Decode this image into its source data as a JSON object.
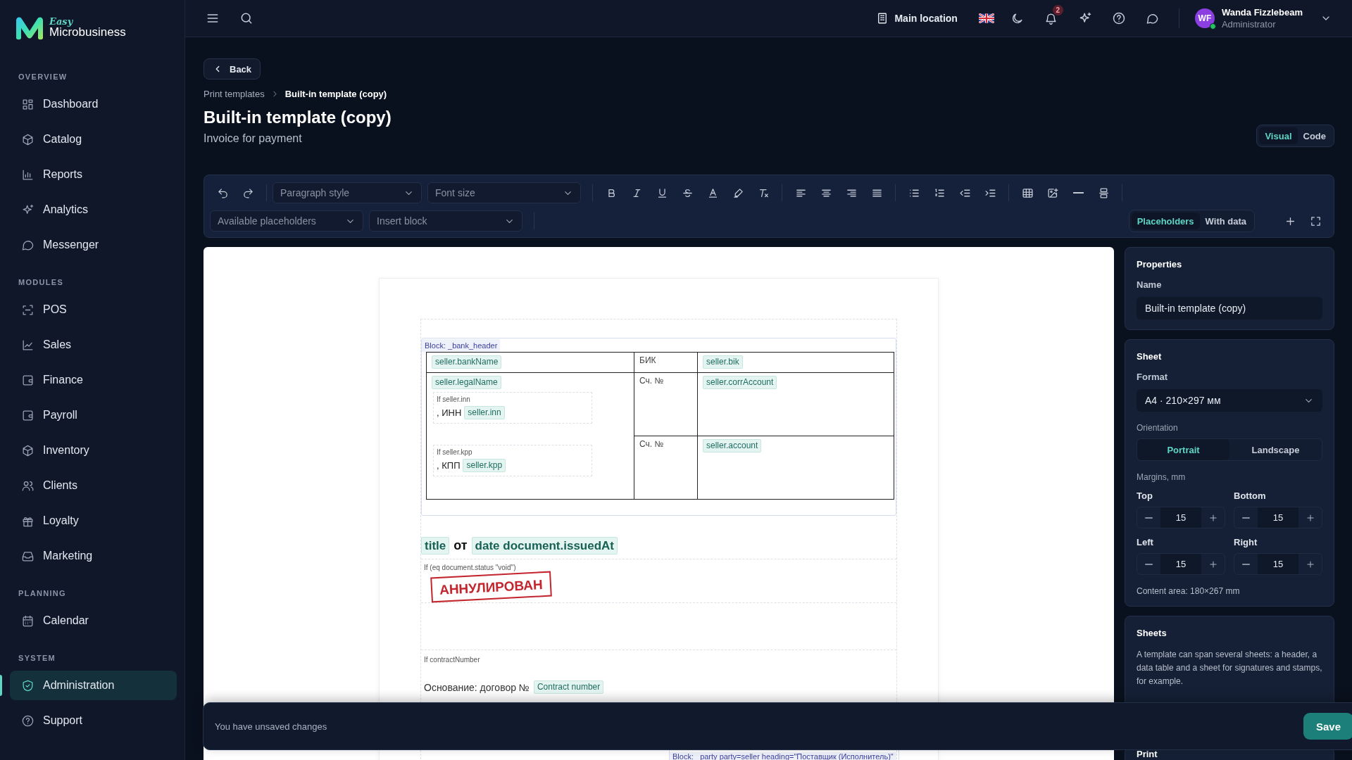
{
  "sidebar": {
    "logo": {
      "tagline": "Easy",
      "name": "Microbusiness"
    },
    "sections": [
      {
        "heading": "OVERVIEW",
        "items": [
          {
            "label": "Dashboard",
            "selected": false
          },
          {
            "label": "Catalog",
            "selected": false
          },
          {
            "label": "Reports",
            "selected": false
          },
          {
            "label": "Analytics",
            "selected": false
          },
          {
            "label": "Messenger",
            "selected": false
          }
        ]
      },
      {
        "heading": "MODULES",
        "items": [
          {
            "label": "POS",
            "selected": false
          },
          {
            "label": "Sales",
            "selected": false
          },
          {
            "label": "Finance",
            "selected": false
          },
          {
            "label": "Payroll",
            "selected": false
          },
          {
            "label": "Inventory",
            "selected": false
          },
          {
            "label": "Clients",
            "selected": false
          },
          {
            "label": "Loyalty",
            "selected": false
          },
          {
            "label": "Marketing",
            "selected": false
          }
        ]
      },
      {
        "heading": "PLANNING",
        "items": [
          {
            "label": "Calendar",
            "selected": false
          }
        ]
      },
      {
        "heading": "SYSTEM",
        "items": [
          {
            "label": "Administration",
            "selected": true
          },
          {
            "label": "Support",
            "selected": false
          }
        ]
      }
    ]
  },
  "topbar": {
    "location": "Main location",
    "notification_count": "2",
    "user": {
      "initials": "WF",
      "name": "Wanda Fizzlebeam",
      "role": "Administrator",
      "online": true
    }
  },
  "page": {
    "back": "Back",
    "breadcrumb": [
      "Print templates",
      "Built-in template (copy)"
    ],
    "title": "Built-in template (copy)",
    "subtitle": "Invoice for payment",
    "view_modes": [
      {
        "label": "Visual",
        "selected": true
      },
      {
        "label": "Code",
        "selected": false
      }
    ]
  },
  "toolbar": {
    "paragraph_style": {
      "placeholder": "Paragraph style"
    },
    "font_size": {
      "placeholder": "Font size"
    },
    "available_placeholders": {
      "placeholder": "Available placeholders"
    },
    "insert_block": {
      "placeholder": "Insert block"
    },
    "preview_modes": [
      {
        "label": "Placeholders",
        "selected": true
      },
      {
        "label": "With data",
        "selected": false
      }
    ]
  },
  "document": {
    "bank_block": {
      "label": "Block: _bank_header",
      "bank_name": "seller.bankName",
      "bik_label": "БИК",
      "bik": "seller.bik",
      "legal_name": "seller.legalName",
      "conditions": [
        {
          "label": "If seller.inn",
          "prefix": ", ИНН",
          "field": "seller.inn"
        },
        {
          "label": "If seller.kpp",
          "prefix": ", КПП",
          "field": "seller.kpp"
        }
      ],
      "accounts": [
        {
          "label": "Сч. №",
          "field": "seller.corrAccount"
        },
        {
          "label": "Сч. №",
          "field": "seller.account"
        }
      ]
    },
    "heading": {
      "title": "title",
      "connector": "от",
      "date": "date document.issuedAt"
    },
    "void_condition": {
      "label": "If (eq document.status \"void\")",
      "stamp": "АННУЛИРОВАН"
    },
    "contract_condition": {
      "label": "If contractNumber",
      "prefix": "Основание: договор №",
      "field": "Contract number"
    },
    "party_block": {
      "label": "Block: _party party=seller heading=\"Поставщик (Исполнитель)\""
    }
  },
  "properties": {
    "heading": "Properties",
    "name_label": "Name",
    "name_value": "Built-in template (copy)"
  },
  "sheet": {
    "heading": "Sheet",
    "format_label": "Format",
    "format_value": "A4 · 210×297 мм",
    "orientation_label": "Orientation",
    "orientations": [
      {
        "label": "Portrait",
        "selected": true
      },
      {
        "label": "Landscape",
        "selected": false
      }
    ],
    "margins_label": "Margins, mm",
    "margins": [
      {
        "label": "Top",
        "value": "15"
      },
      {
        "label": "Bottom",
        "value": "15"
      },
      {
        "label": "Left",
        "value": "15"
      },
      {
        "label": "Right",
        "value": "15"
      }
    ],
    "content_area": "Content area: 180×267 mm"
  },
  "sheets": {
    "heading": "Sheets",
    "description": "A template can span several sheets: a header, a data table and a sheet for signatures and stamps, for example."
  },
  "print": {
    "heading": "Print"
  },
  "unsaved_bar": {
    "message": "You have unsaved changes",
    "save": "Save"
  }
}
